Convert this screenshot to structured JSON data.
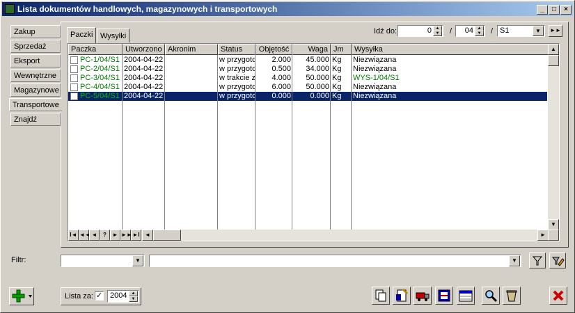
{
  "window": {
    "title": "Lista dokumentów handlowych, magazynowych i transportowych",
    "minimize": "_",
    "maximize": "□",
    "close": "×"
  },
  "sidebar": {
    "items": [
      {
        "label": "Zakup"
      },
      {
        "label": "Sprzedaż"
      },
      {
        "label": "Eksport"
      },
      {
        "label": "Wewnętrzne"
      },
      {
        "label": "Magazynowe"
      },
      {
        "label": "Transportowe"
      },
      {
        "label": "Znajdź"
      }
    ],
    "active": "Transportowe"
  },
  "tabs": [
    {
      "label": "Paczki"
    },
    {
      "label": "Wysyłki"
    }
  ],
  "goto": {
    "label": "Idź do:",
    "day": "0",
    "separator1": "/",
    "month": "04",
    "separator2": "/",
    "series": "S1"
  },
  "table": {
    "columns": [
      "Paczka",
      "Utworzono",
      "Akronim",
      "Status",
      "Objętość",
      "Waga",
      "Jm",
      "Wysyłka"
    ],
    "rows": [
      {
        "paczka": "PC-1/04/S1",
        "utworzono": "2004-04-22",
        "akronim": "",
        "status": "w przygotowaniu",
        "objetosc": "2.000",
        "waga": "45.000",
        "jm": "Kg",
        "wysylka": "Niezwiązana"
      },
      {
        "paczka": "PC-2/04/S1",
        "utworzono": "2004-04-22",
        "akronim": "",
        "status": "w przygotowaniu",
        "objetosc": "0.500",
        "waga": "34.000",
        "jm": "Kg",
        "wysylka": "Niezwiązana"
      },
      {
        "paczka": "PC-3/04/S1",
        "utworzono": "2004-04-22",
        "akronim": "",
        "status": "w trakcie załadunku",
        "objetosc": "4.000",
        "waga": "50.000",
        "jm": "Kg",
        "wysylka": "WYS-1/04/S1"
      },
      {
        "paczka": "PC-4/04/S1",
        "utworzono": "2004-04-22",
        "akronim": "",
        "status": "w przygotowaniu",
        "objetosc": "6.000",
        "waga": "50.000",
        "jm": "Kg",
        "wysylka": "Niezwiązana"
      },
      {
        "paczka": "PC-5/04/S1",
        "utworzono": "2004-04-22",
        "akronim": "",
        "status": "w przygotowaniu",
        "objetosc": "0.000",
        "waga": "0.000",
        "jm": "Kg",
        "wysylka": "Niezwiązana"
      }
    ],
    "selected_row": 4,
    "nav": [
      "I◄",
      "◄◄",
      "◄",
      "?",
      "►",
      "►►",
      "►I"
    ]
  },
  "filter": {
    "label": "Filtr:",
    "field1": "",
    "field2": ""
  },
  "bottom": {
    "lista_za_label": "Lista za:",
    "lista_za_checked": true,
    "year": "2004"
  },
  "colors": {
    "title_start": "#0a246a",
    "title_end": "#a6caf0",
    "selection": "#0a246a",
    "green_text": "#007a00",
    "close_red": "#cc0000"
  },
  "icons": [
    "add-icon",
    "filter-icon",
    "filter-edit-icon",
    "print-icon",
    "document-icon",
    "truck-icon",
    "register-icon",
    "table-icon",
    "search-icon",
    "trash-icon",
    "close-icon"
  ]
}
